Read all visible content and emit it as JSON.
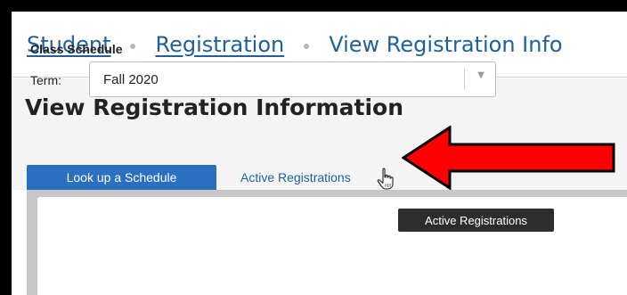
{
  "breadcrumb": {
    "items": [
      {
        "label": "Student",
        "link": true
      },
      {
        "label": "Registration",
        "link": true
      },
      {
        "label": "View Registration Info",
        "link": false
      }
    ]
  },
  "page": {
    "title": "View Registration Information"
  },
  "tabs": [
    {
      "label": "Look up a Schedule",
      "active": true
    },
    {
      "label": "Active Registrations",
      "active": false
    }
  ],
  "schedule": {
    "section_title": "Class Schedule",
    "term_label": "Term:",
    "term_value": "Fall 2020"
  },
  "tooltip": {
    "text": "Active Registrations"
  },
  "colors": {
    "link": "#1f5f9e",
    "active_tab": "#2b6fc0",
    "annotation_arrow": "#ff0000",
    "tooltip_bg": "#2d2d2d"
  },
  "icons": {
    "select_chevron": "chevron-down-icon",
    "pointer": "hand-pointer-icon",
    "annotation": "red-arrow-icon"
  }
}
